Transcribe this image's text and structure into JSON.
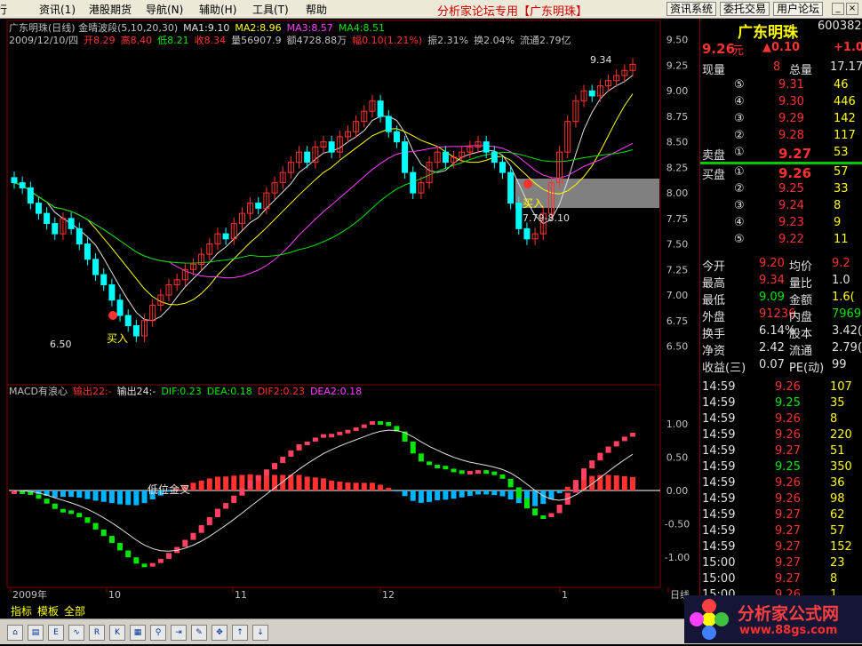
{
  "menu": {
    "items": [
      "行",
      "资讯(1)",
      "港股期货",
      "导航(N)",
      "辅助(H)",
      "工具(T)",
      "帮助"
    ],
    "title": "分析家论坛专用【广东明珠】",
    "buttons": [
      "资讯系统",
      "委托交易",
      "用户论坛"
    ]
  },
  "header": {
    "line1": [
      {
        "t": "广东明珠(日线) 金晴波段(5,10,20,30)",
        "c": "#c0c0c0"
      },
      {
        "t": "MA1:9.10",
        "c": "#e0e0e0"
      },
      {
        "t": "MA2:8.96",
        "c": "#ffff00"
      },
      {
        "t": "MA3:8.57",
        "c": "#ff40ff"
      },
      {
        "t": "MA4:8.51",
        "c": "#00e600"
      }
    ],
    "line2": [
      {
        "t": "2009/12/10/四",
        "c": "#c0c0c0"
      },
      {
        "t": "开8.29",
        "c": "#ff3232"
      },
      {
        "t": "高8.40",
        "c": "#ff3232"
      },
      {
        "t": "低8.21",
        "c": "#00e600"
      },
      {
        "t": "收8.34",
        "c": "#ff3232"
      },
      {
        "t": "量56907.9",
        "c": "#c0c0c0"
      },
      {
        "t": "额4728.88万",
        "c": "#c0c0c0"
      },
      {
        "t": "幅0.10(1.21%)",
        "c": "#ff3232"
      },
      {
        "t": "振2.31%",
        "c": "#c0c0c0"
      },
      {
        "t": "换2.04%",
        "c": "#c0c0c0"
      },
      {
        "t": "流通2.79亿",
        "c": "#c0c0c0"
      }
    ]
  },
  "price_axis": [
    "9.50",
    "9.25",
    "9.00",
    "8.75",
    "8.50",
    "8.25",
    "8.00",
    "7.75",
    "7.50",
    "7.25",
    "7.00",
    "6.75",
    "6.50"
  ],
  "macd_axis": [
    "1.00",
    "0.50",
    "0.00",
    "-0.50",
    "-1.00"
  ],
  "annotations": {
    "low_label": "6.50",
    "buy1": "买入",
    "buy2": "买入",
    "zone_label": "7.79-8.10",
    "high_label": "9.34",
    "cross_label": "低位金叉"
  },
  "macd_header": [
    {
      "t": "MACD有浪心",
      "c": "#c0c0c0"
    },
    {
      "t": "输出22:-",
      "c": "#ff3232"
    },
    {
      "t": "输出24:-",
      "c": "#e0e0e0"
    },
    {
      "t": "DIF:0.23",
      "c": "#00e600"
    },
    {
      "t": "DEA:0.18",
      "c": "#00e600"
    },
    {
      "t": "DIF2:0.23",
      "c": "#ff3232"
    },
    {
      "t": "DEA2:0.18",
      "c": "#ff40ff"
    }
  ],
  "date_axis": [
    "2009年",
    "10",
    "11",
    "12",
    "1",
    "日线"
  ],
  "tabs": [
    "指标",
    "模板",
    "全部"
  ],
  "quote": {
    "name": "广东明珠",
    "code": "600382",
    "price": "9.26",
    "price_unit": "元",
    "change": "▲0.10",
    "change2": "+1.0",
    "now_vol_label": "现量",
    "now_vol": "8",
    "total_label": "总量",
    "total": "17.17",
    "sell": [
      {
        "n": "⑤",
        "p": "9.31",
        "v": "46"
      },
      {
        "n": "④",
        "p": "9.30",
        "v": "446"
      },
      {
        "n": "③",
        "p": "9.29",
        "v": "142"
      },
      {
        "n": "②",
        "p": "9.28",
        "v": "117"
      },
      {
        "n": "①",
        "p": "9.27",
        "v": "53"
      }
    ],
    "sell_label": "卖盘",
    "buy_label": "买盘",
    "buy": [
      {
        "n": "①",
        "p": "9.26",
        "v": "57"
      },
      {
        "n": "②",
        "p": "9.25",
        "v": "33"
      },
      {
        "n": "③",
        "p": "9.24",
        "v": "8"
      },
      {
        "n": "④",
        "p": "9.23",
        "v": "9"
      },
      {
        "n": "⑤",
        "p": "9.22",
        "v": "11"
      }
    ],
    "stats": [
      {
        "l1": "今开",
        "v1": "9.20",
        "c1": "red",
        "l2": "均价",
        "v2": "9.2",
        "c2": "red"
      },
      {
        "l1": "最高",
        "v1": "9.34",
        "c1": "red",
        "l2": "量比",
        "v2": "1.0",
        "c2": "wht"
      },
      {
        "l1": "最低",
        "v1": "9.09",
        "c1": "grn",
        "l2": "金额",
        "v2": "1.6(",
        "c2": "yel"
      },
      {
        "l1": "外盘",
        "v1": "91236",
        "c1": "red",
        "l2": "内盘",
        "v2": "7969",
        "c2": "grn"
      },
      {
        "l1": "换手",
        "v1": "6.14%",
        "c1": "wht",
        "l2": "股本",
        "v2": "3.42(",
        "c2": "wht"
      },
      {
        "l1": "净资",
        "v1": "2.42",
        "c1": "wht",
        "l2": "流通",
        "v2": "2.79(",
        "c2": "wht"
      },
      {
        "l1": "收益(三)",
        "v1": "0.07",
        "c1": "wht",
        "l2": "PE(动)",
        "v2": "99",
        "c2": "wht"
      }
    ],
    "ticks": [
      {
        "t": "14:59",
        "p": "9.26",
        "v": "107",
        "c": "red"
      },
      {
        "t": "14:59",
        "p": "9.25",
        "v": "35",
        "c": "grn"
      },
      {
        "t": "14:59",
        "p": "9.26",
        "v": "8",
        "c": "red"
      },
      {
        "t": "14:59",
        "p": "9.26",
        "v": "220",
        "c": "red"
      },
      {
        "t": "14:59",
        "p": "9.27",
        "v": "51",
        "c": "red"
      },
      {
        "t": "14:59",
        "p": "9.25",
        "v": "350",
        "c": "grn"
      },
      {
        "t": "14:59",
        "p": "9.26",
        "v": "36",
        "c": "red"
      },
      {
        "t": "14:59",
        "p": "9.26",
        "v": "98",
        "c": "red"
      },
      {
        "t": "14:59",
        "p": "9.27",
        "v": "62",
        "c": "red"
      },
      {
        "t": "14:59",
        "p": "9.27",
        "v": "57",
        "c": "red"
      },
      {
        "t": "14:59",
        "p": "9.27",
        "v": "152",
        "c": "red"
      },
      {
        "t": "15:00",
        "p": "9.27",
        "v": "23",
        "c": "red"
      },
      {
        "t": "15:00",
        "p": "9.27",
        "v": "8",
        "c": "red"
      },
      {
        "t": "15:00",
        "p": "9.26",
        "v": "1",
        "c": "red"
      }
    ]
  },
  "logo": {
    "title": "分析家公式网",
    "url": "www.88gs.com"
  },
  "toolbar_icons": [
    "home-icon",
    "bar-icon",
    "etf-icon",
    "wave-icon",
    "rsi-icon",
    "kd-icon",
    "chart-icon",
    "pin-icon",
    "export-icon",
    "pencil-icon",
    "move-icon",
    "up-arrow-icon",
    "down-arrow-icon"
  ],
  "chart_data": {
    "type": "candlestick",
    "closes": [
      8.1,
      8.05,
      7.9,
      7.8,
      7.7,
      7.6,
      7.75,
      7.65,
      7.5,
      7.35,
      7.2,
      7.1,
      6.95,
      6.8,
      6.7,
      6.6,
      6.75,
      6.9,
      7.0,
      7.1,
      7.15,
      7.25,
      7.3,
      7.4,
      7.5,
      7.6,
      7.55,
      7.7,
      7.8,
      7.9,
      7.85,
      8.0,
      8.1,
      8.2,
      8.3,
      8.4,
      8.3,
      8.45,
      8.5,
      8.4,
      8.55,
      8.6,
      8.7,
      8.8,
      8.9,
      8.75,
      8.6,
      8.5,
      8.2,
      8.0,
      8.1,
      8.3,
      8.4,
      8.3,
      8.35,
      8.4,
      8.45,
      8.5,
      8.4,
      8.3,
      8.2,
      7.9,
      7.65,
      7.55,
      7.6,
      7.8,
      8.1,
      8.4,
      8.7,
      8.9,
      9.0,
      8.95,
      9.05,
      9.1,
      9.15,
      9.2,
      9.26
    ],
    "ylim": [
      6.4,
      9.55
    ],
    "macd_ylim": [
      -1.35,
      1.35
    ]
  }
}
